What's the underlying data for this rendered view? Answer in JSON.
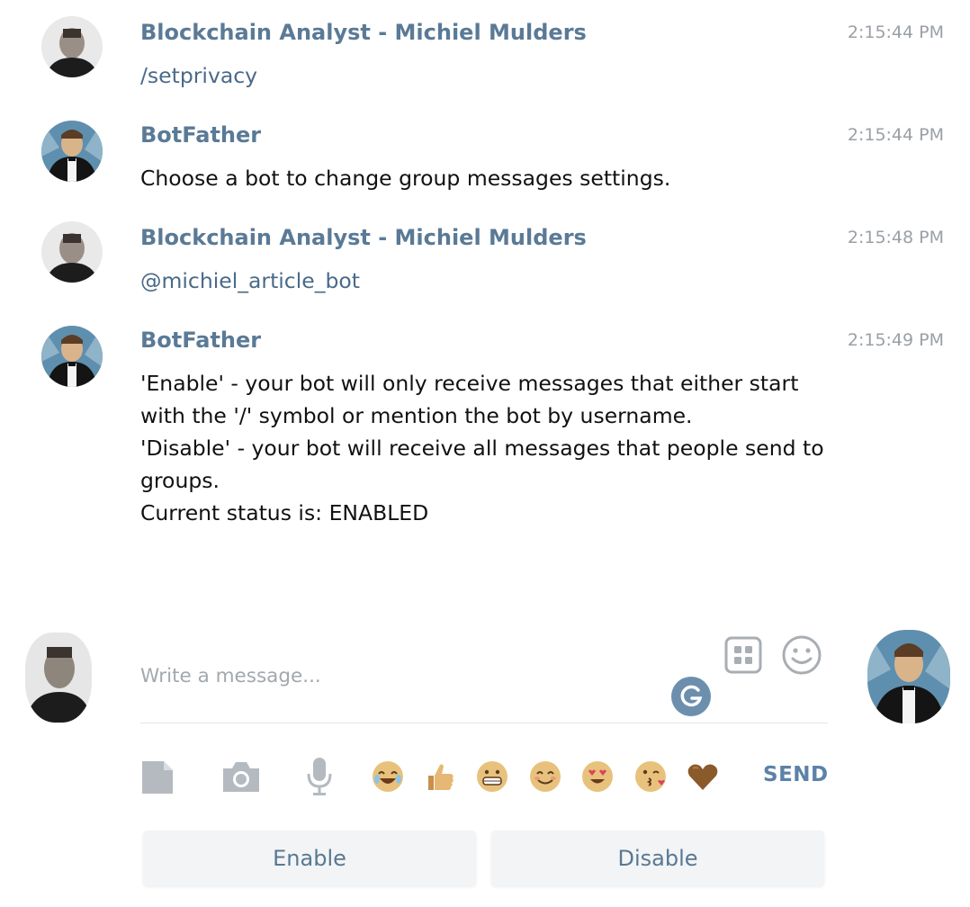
{
  "messages": [
    {
      "author": "Blockchain Analyst - Michiel Mulders",
      "time": "2:15:44 PM",
      "lines": [
        "/setprivacy"
      ],
      "avatar": "user-avatar"
    },
    {
      "author": "BotFather",
      "time": "2:15:44 PM",
      "lines": [
        "Choose a bot to change group messages settings."
      ],
      "avatar": "botfather-avatar"
    },
    {
      "author": "Blockchain Analyst - Michiel Mulders",
      "time": "2:15:48 PM",
      "lines": [
        "@michiel_article_bot"
      ],
      "avatar": "user-avatar"
    },
    {
      "author": "BotFather",
      "time": "2:15:49 PM",
      "lines": [
        "'Enable' - your bot will only receive messages that either start",
        "with the '/' symbol or mention the bot by username.",
        "'Disable' - your bot will receive all messages that people send to",
        "groups.",
        "Current status is: ENABLED"
      ],
      "avatar": "botfather-avatar"
    }
  ],
  "composer": {
    "placeholder": "Write a message...",
    "send_label": "SEND",
    "grammar_badge": "G"
  },
  "toolbar": {
    "icons": [
      "attach-file-icon",
      "camera-icon",
      "microphone-icon"
    ],
    "emojis": [
      "joy-emoji",
      "thumbs-up-emoji",
      "grimace-emoji",
      "smile-emoji",
      "heart-eyes-emoji",
      "kiss-emoji",
      "brown-heart-emoji"
    ]
  },
  "keyboard": {
    "buttons": [
      "Enable",
      "Disable"
    ]
  },
  "colors": {
    "author": "#5a7a96",
    "link": "#4a6a88",
    "send": "#5b82a8",
    "icon_gray": "#b4babf"
  }
}
